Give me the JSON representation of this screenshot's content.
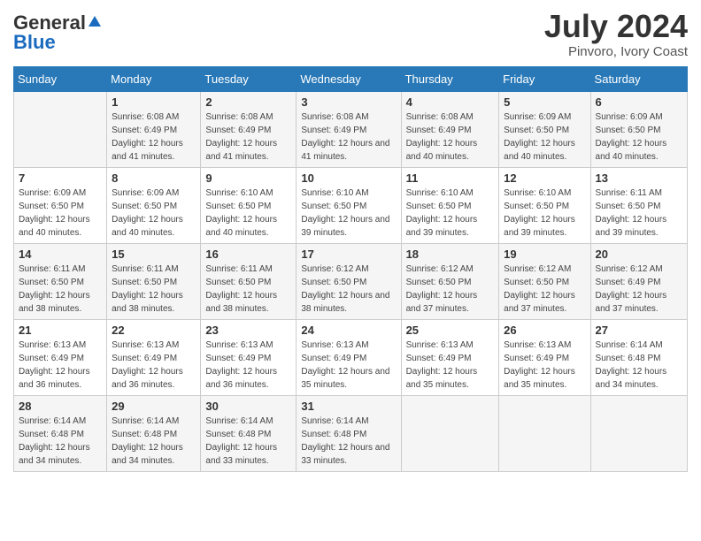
{
  "header": {
    "logo_general": "General",
    "logo_blue": "Blue",
    "month_year": "July 2024",
    "location": "Pinvoro, Ivory Coast"
  },
  "days_of_week": [
    "Sunday",
    "Monday",
    "Tuesday",
    "Wednesday",
    "Thursday",
    "Friday",
    "Saturday"
  ],
  "weeks": [
    [
      {
        "num": "",
        "sunrise": "",
        "sunset": "",
        "daylight": ""
      },
      {
        "num": "1",
        "sunrise": "6:08 AM",
        "sunset": "6:49 PM",
        "daylight": "12 hours and 41 minutes."
      },
      {
        "num": "2",
        "sunrise": "6:08 AM",
        "sunset": "6:49 PM",
        "daylight": "12 hours and 41 minutes."
      },
      {
        "num": "3",
        "sunrise": "6:08 AM",
        "sunset": "6:49 PM",
        "daylight": "12 hours and 41 minutes."
      },
      {
        "num": "4",
        "sunrise": "6:08 AM",
        "sunset": "6:49 PM",
        "daylight": "12 hours and 40 minutes."
      },
      {
        "num": "5",
        "sunrise": "6:09 AM",
        "sunset": "6:50 PM",
        "daylight": "12 hours and 40 minutes."
      },
      {
        "num": "6",
        "sunrise": "6:09 AM",
        "sunset": "6:50 PM",
        "daylight": "12 hours and 40 minutes."
      }
    ],
    [
      {
        "num": "7",
        "sunrise": "6:09 AM",
        "sunset": "6:50 PM",
        "daylight": "12 hours and 40 minutes."
      },
      {
        "num": "8",
        "sunrise": "6:09 AM",
        "sunset": "6:50 PM",
        "daylight": "12 hours and 40 minutes."
      },
      {
        "num": "9",
        "sunrise": "6:10 AM",
        "sunset": "6:50 PM",
        "daylight": "12 hours and 40 minutes."
      },
      {
        "num": "10",
        "sunrise": "6:10 AM",
        "sunset": "6:50 PM",
        "daylight": "12 hours and 39 minutes."
      },
      {
        "num": "11",
        "sunrise": "6:10 AM",
        "sunset": "6:50 PM",
        "daylight": "12 hours and 39 minutes."
      },
      {
        "num": "12",
        "sunrise": "6:10 AM",
        "sunset": "6:50 PM",
        "daylight": "12 hours and 39 minutes."
      },
      {
        "num": "13",
        "sunrise": "6:11 AM",
        "sunset": "6:50 PM",
        "daylight": "12 hours and 39 minutes."
      }
    ],
    [
      {
        "num": "14",
        "sunrise": "6:11 AM",
        "sunset": "6:50 PM",
        "daylight": "12 hours and 38 minutes."
      },
      {
        "num": "15",
        "sunrise": "6:11 AM",
        "sunset": "6:50 PM",
        "daylight": "12 hours and 38 minutes."
      },
      {
        "num": "16",
        "sunrise": "6:11 AM",
        "sunset": "6:50 PM",
        "daylight": "12 hours and 38 minutes."
      },
      {
        "num": "17",
        "sunrise": "6:12 AM",
        "sunset": "6:50 PM",
        "daylight": "12 hours and 38 minutes."
      },
      {
        "num": "18",
        "sunrise": "6:12 AM",
        "sunset": "6:50 PM",
        "daylight": "12 hours and 37 minutes."
      },
      {
        "num": "19",
        "sunrise": "6:12 AM",
        "sunset": "6:50 PM",
        "daylight": "12 hours and 37 minutes."
      },
      {
        "num": "20",
        "sunrise": "6:12 AM",
        "sunset": "6:49 PM",
        "daylight": "12 hours and 37 minutes."
      }
    ],
    [
      {
        "num": "21",
        "sunrise": "6:13 AM",
        "sunset": "6:49 PM",
        "daylight": "12 hours and 36 minutes."
      },
      {
        "num": "22",
        "sunrise": "6:13 AM",
        "sunset": "6:49 PM",
        "daylight": "12 hours and 36 minutes."
      },
      {
        "num": "23",
        "sunrise": "6:13 AM",
        "sunset": "6:49 PM",
        "daylight": "12 hours and 36 minutes."
      },
      {
        "num": "24",
        "sunrise": "6:13 AM",
        "sunset": "6:49 PM",
        "daylight": "12 hours and 35 minutes."
      },
      {
        "num": "25",
        "sunrise": "6:13 AM",
        "sunset": "6:49 PM",
        "daylight": "12 hours and 35 minutes."
      },
      {
        "num": "26",
        "sunrise": "6:13 AM",
        "sunset": "6:49 PM",
        "daylight": "12 hours and 35 minutes."
      },
      {
        "num": "27",
        "sunrise": "6:14 AM",
        "sunset": "6:48 PM",
        "daylight": "12 hours and 34 minutes."
      }
    ],
    [
      {
        "num": "28",
        "sunrise": "6:14 AM",
        "sunset": "6:48 PM",
        "daylight": "12 hours and 34 minutes."
      },
      {
        "num": "29",
        "sunrise": "6:14 AM",
        "sunset": "6:48 PM",
        "daylight": "12 hours and 34 minutes."
      },
      {
        "num": "30",
        "sunrise": "6:14 AM",
        "sunset": "6:48 PM",
        "daylight": "12 hours and 33 minutes."
      },
      {
        "num": "31",
        "sunrise": "6:14 AM",
        "sunset": "6:48 PM",
        "daylight": "12 hours and 33 minutes."
      },
      {
        "num": "",
        "sunrise": "",
        "sunset": "",
        "daylight": ""
      },
      {
        "num": "",
        "sunrise": "",
        "sunset": "",
        "daylight": ""
      },
      {
        "num": "",
        "sunrise": "",
        "sunset": "",
        "daylight": ""
      }
    ]
  ]
}
